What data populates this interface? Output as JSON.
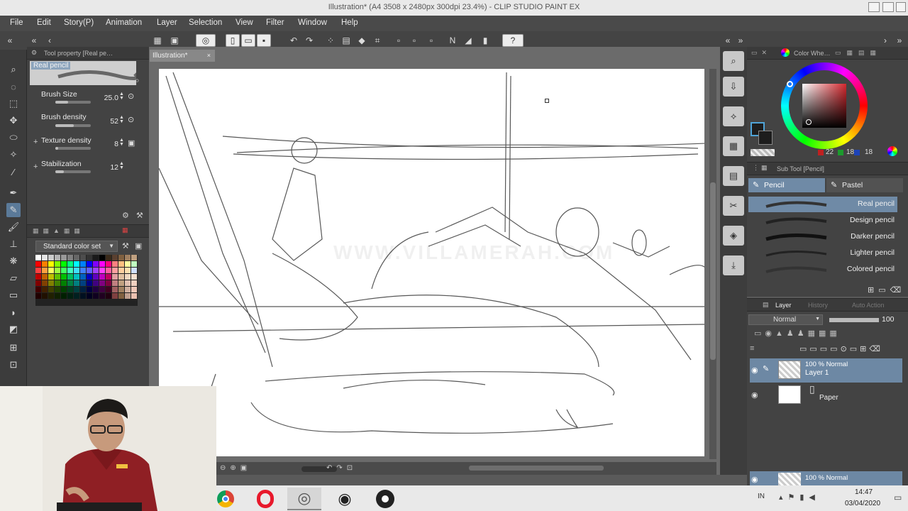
{
  "window": {
    "title": "Illustration* (A4 3508 x 2480px 300dpi 23.4%) - CLIP STUDIO PAINT EX"
  },
  "menu": [
    "File",
    "Edit",
    "Story(P)",
    "Animation",
    "Layer",
    "Selection",
    "View",
    "Filter",
    "Window",
    "Help"
  ],
  "document_tab": "Illustration*",
  "tool_property": {
    "header": "Tool property [Real pe…",
    "brush_name": "Real pencil",
    "properties": [
      {
        "label": "Brush Size",
        "value": "25.0",
        "fraction": 0.35
      },
      {
        "label": "Brush density",
        "value": "52",
        "fraction": 0.52
      },
      {
        "label": "Texture density",
        "value": "8",
        "fraction": 0.08
      },
      {
        "label": "Stabilization",
        "value": "12",
        "fraction": 0.24
      }
    ]
  },
  "color_set": {
    "name": "Standard color set"
  },
  "color_wheel": {
    "header": "Color Whe…",
    "main_color": "#1d1d1d",
    "sub_color": "#ffffff",
    "values": [
      "22",
      "18",
      "18"
    ]
  },
  "sub_tool": {
    "header": "Sub Tool [Pencil]",
    "tabs": [
      "Pencil",
      "Pastel"
    ],
    "brushes": [
      "Real pencil",
      "Design pencil",
      "Darker pencil",
      "Lighter pencil",
      "Colored pencil"
    ]
  },
  "layer_panel": {
    "tabs": [
      "Layer",
      "History",
      "Auto Action"
    ],
    "blend_mode": "Normal",
    "opacity": "100",
    "layers": [
      {
        "mode": "100 % Normal",
        "name": "Layer 1"
      },
      {
        "mode": "",
        "name": "Paper"
      }
    ],
    "bottom_layer_mode": "100 % Normal"
  },
  "watermark": "WWW.VILLAMERAH.COM",
  "taskbar": {
    "lang": "IN",
    "time": "14:47",
    "date": "03/04/2020"
  },
  "colors": {
    "accent": "#6f8aa6",
    "panel_bg": "#434343",
    "shirt": "#8f1f24"
  }
}
